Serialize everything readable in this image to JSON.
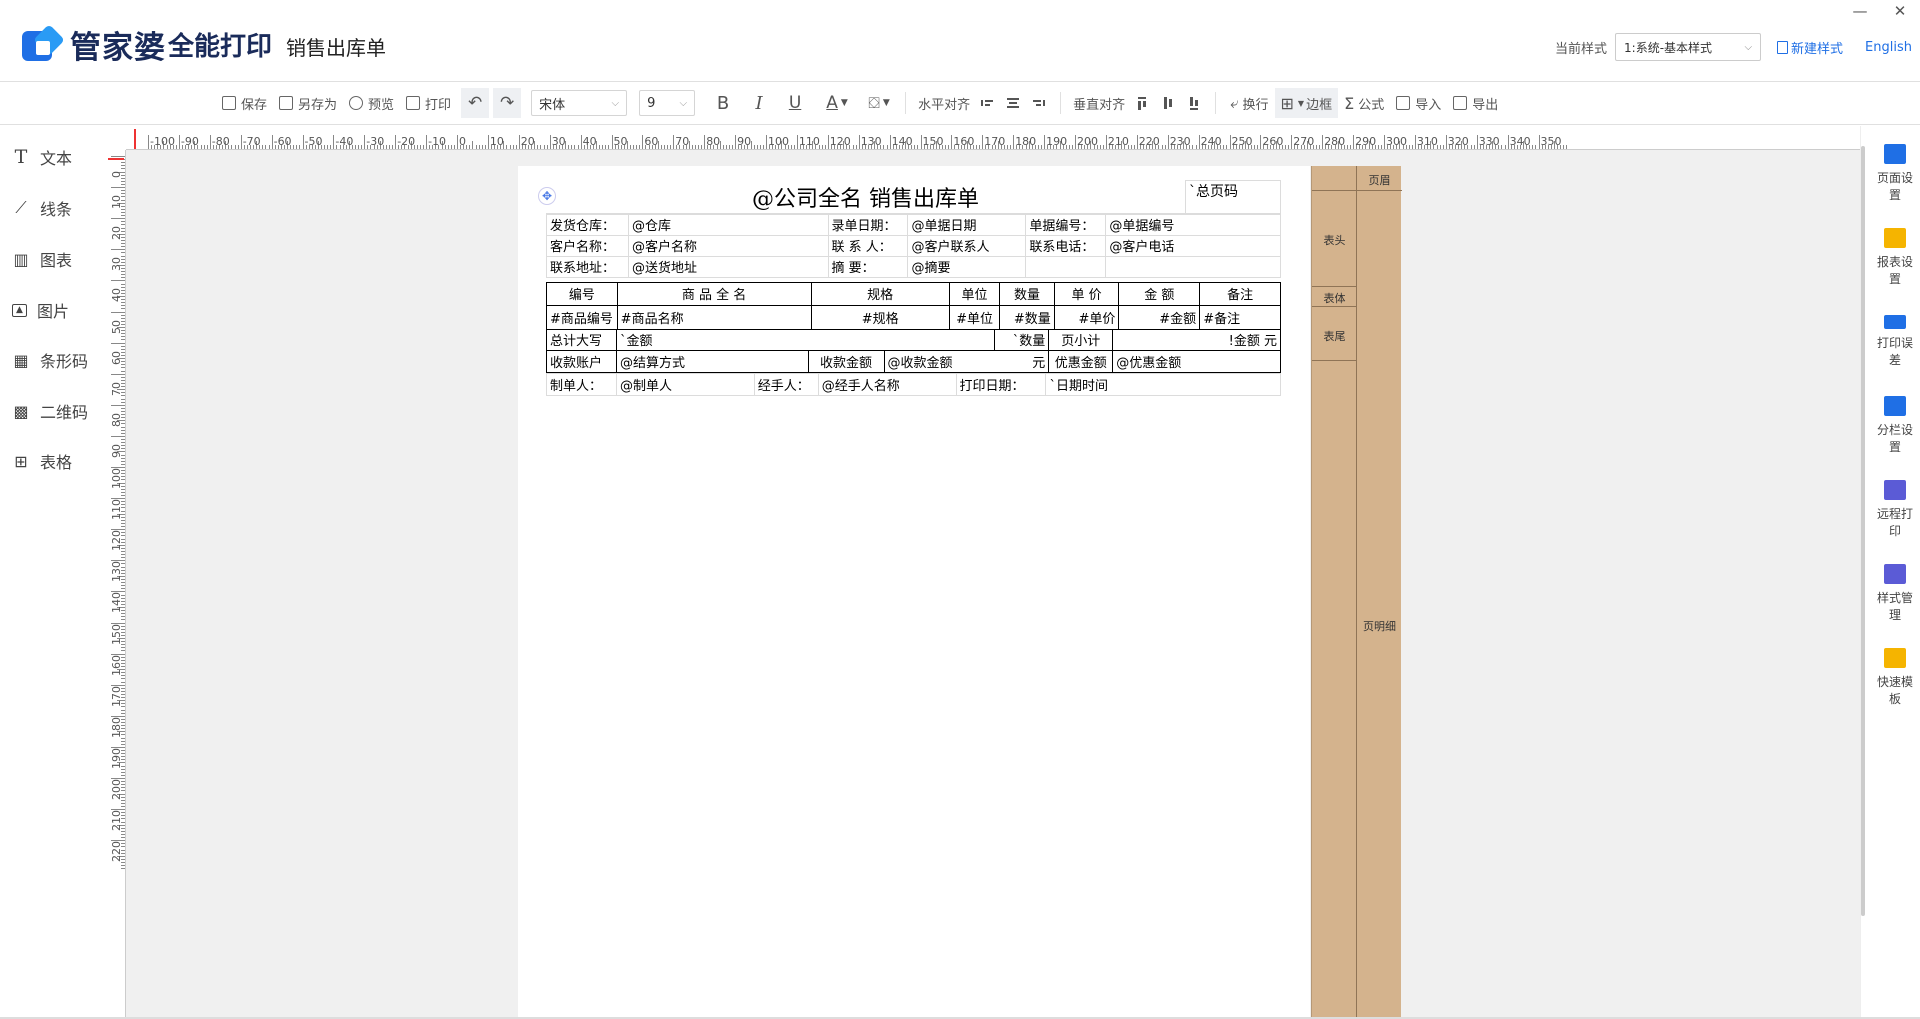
{
  "header": {
    "logo_name": "管家婆",
    "logo_sub": "全能打印",
    "page_title": "销售出库单",
    "style_label": "当前样式",
    "style_value": "1:系统-基本样式",
    "new_style": "新建样式",
    "language": "English",
    "minimize": "—",
    "close": "✕"
  },
  "toolbar": {
    "save": "保存",
    "save_as": "另存为",
    "preview": "预览",
    "print": "打印",
    "font": "宋体",
    "font_size": "9",
    "bold": "B",
    "italic": "I",
    "underline": "U",
    "font_color": "A",
    "h_align": "水平对齐",
    "v_align": "垂直对齐",
    "wrap": "换行",
    "border": "边框",
    "formula": "公式",
    "import": "导入",
    "export": "导出"
  },
  "left_tools": [
    {
      "icon": "T",
      "label": "文本"
    },
    {
      "icon": "⟋",
      "label": "线条"
    },
    {
      "icon": "▥",
      "label": "图表"
    },
    {
      "icon": "🖼",
      "label": "图片"
    },
    {
      "icon": "▦",
      "label": "条形码"
    },
    {
      "icon": "▩",
      "label": "二维码"
    },
    {
      "icon": "⊞",
      "label": "表格"
    }
  ],
  "right_tools": [
    {
      "label": "页面设置",
      "color": "#1f6fe5"
    },
    {
      "label": "报表设置",
      "color": "#f5b400"
    },
    {
      "label": "打印误差",
      "color": "#1f6fe5"
    },
    {
      "label": "分栏设置",
      "color": "#1f6fe5"
    },
    {
      "label": "远程打印",
      "color": "#5b5bd6"
    },
    {
      "label": "样式管理",
      "color": "#5b5bd6"
    },
    {
      "label": "快速模板",
      "color": "#f5b400"
    }
  ],
  "ruler": {
    "h_labels": [
      "-100",
      "-90",
      "-80",
      "-70",
      "-60",
      "-50",
      "-40",
      "-30",
      "-20",
      "-10",
      "0",
      "10",
      "20",
      "30",
      "40",
      "50",
      "60",
      "70",
      "80",
      "90",
      "100",
      "110",
      "120",
      "130",
      "140",
      "150",
      "160",
      "170",
      "180",
      "190",
      "200",
      "210",
      "220",
      "230",
      "240",
      "250",
      "260",
      "270",
      "280",
      "290",
      "300",
      "310",
      "320",
      "330",
      "340",
      "350"
    ],
    "v_labels": [
      "0",
      "10",
      "20",
      "30",
      "40",
      "50",
      "60",
      "70",
      "80",
      "90",
      "100",
      "110",
      "120",
      "130",
      "140",
      "150",
      "160",
      "170",
      "180",
      "190",
      "200",
      "210",
      "220"
    ]
  },
  "bands": {
    "header": "页眉",
    "table_head": "表头",
    "table_body": "表体",
    "table_tail": "表尾",
    "detail": "页明细"
  },
  "form": {
    "title": "@公司全名 销售出库单",
    "total_pages": "`总页码",
    "info_rows": [
      [
        "发货仓库：",
        "@仓库",
        "录单日期：",
        "@单据日期",
        "单据编号：",
        "@单据编号"
      ],
      [
        "客户名称：",
        "@客户名称",
        "联 系 人：",
        "@客户联系人",
        "联系电话：",
        "@客户电话"
      ],
      [
        "联系地址：",
        "@送货地址",
        "摘      要：",
        "@摘要",
        "",
        ""
      ]
    ],
    "columns": [
      "编号",
      "商 品 全 名",
      "规格",
      "单位",
      "数量",
      "单 价",
      "金 额",
      "备注"
    ],
    "detail_row": [
      "#商品编号",
      "#商品名称",
      "#规格",
      "#单位",
      "#数量",
      "#单价",
      "#金额",
      "#备注"
    ],
    "total_row": {
      "label": "总计大写",
      "amount_words": "`金额",
      "qty": "`数量",
      "subtotal_label": "页小计",
      "subtotal": "!金额 元"
    },
    "pay_row": {
      "acct_label": "收款账户",
      "acct": "@结算方式",
      "recv_label": "收款金额",
      "recv": "@收款金额",
      "unit": "元",
      "disc_label": "优惠金额",
      "disc": "@优惠金额"
    },
    "sign_row": [
      "制单人：",
      "@制单人",
      "经手人：",
      "@经手人名称",
      "打印日期：",
      "`日期时间"
    ]
  }
}
